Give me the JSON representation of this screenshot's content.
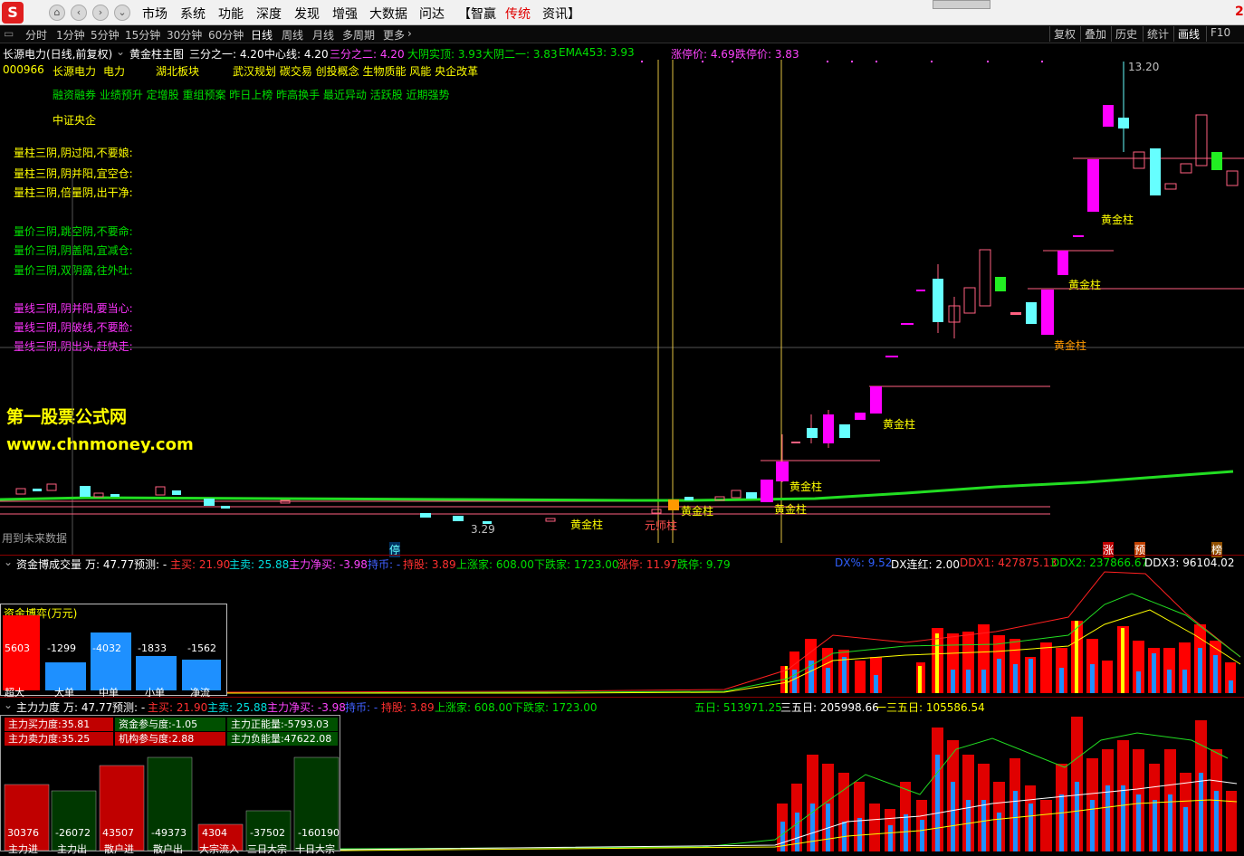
{
  "topbar": {
    "logo": "S",
    "menu": [
      "市场",
      "系统",
      "功能",
      "深度",
      "发现",
      "增强",
      "大数据",
      "问达",
      "【智赢",
      "传统",
      "资讯】"
    ],
    "active_menu": "传统",
    "clock_partial": "2"
  },
  "timeframes": [
    "分时",
    "1分钟",
    "5分钟",
    "15分钟",
    "30分钟",
    "60分钟",
    "日线",
    "周线",
    "月线",
    "多周期",
    "更多"
  ],
  "right_tools": [
    "复权",
    "叠加",
    "历史",
    "统计",
    "画线",
    "F10"
  ],
  "main_header": {
    "stock_title": "长源电力(日线,前复权)",
    "indicator": "黄金柱主图",
    "items": [
      {
        "text": "三分之一: 4.20",
        "color": "#ffffff"
      },
      {
        "text": "中心线: 4.20",
        "color": "#ffffff"
      },
      {
        "text": "三分之二: 4.20",
        "color": "#ff44ff"
      },
      {
        "text": "大阴实顶: 3.93",
        "color": "#00e000"
      },
      {
        "text": "大阴二一: 3.83",
        "color": "#00e000"
      },
      {
        "text": "EMA453: 3.93",
        "color": "#00e000"
      },
      {
        "text": "涨停价: 4.69",
        "color": "#ff44ff"
      },
      {
        "text": "跌停价: 3.83",
        "color": "#ff44ff"
      }
    ]
  },
  "stock_info": {
    "code": "000966",
    "name": "长源电力",
    "industry": "电力",
    "region": "湖北板块",
    "concepts": "武汉规划 碳交易 创投概念 生物质能 风能 央企改革",
    "tags": "融资融券 业绩预升 定增股 重组预案 昨日上榜 昨高换手 最近异动 活跃股 近期强势",
    "index": "中证央企"
  },
  "rules": {
    "yellow": [
      "量柱三阴,阴过阳,不要娘:",
      "量柱三阴,阴并阳,宜空仓:",
      "量柱三阴,倍量阴,出干净:"
    ],
    "green": [
      "量价三阴,跳空阴,不要命:",
      "量价三阴,阴盖阳,宜减仓:",
      "量价三阴,双阴露,往外吐:"
    ],
    "magenta": [
      "量线三阴,阴并阳,要当心:",
      "量线三阴,阴破线,不要脸:",
      "量线三阴,阴出头,赶快走:"
    ]
  },
  "watermark": {
    "name": "第一股票公式网",
    "url": "www.chnmoney.com"
  },
  "chart_notes": {
    "future_data": "用到未来数据",
    "high_price": "13.20",
    "low_price": "3.29",
    "stop_marker": "停",
    "bottom_markers": [
      "涨",
      "预",
      "榜"
    ],
    "golden_labels": [
      "黄金柱",
      "黄金柱",
      "黄金柱",
      "黄金柱",
      "黄金柱",
      "黄金柱",
      "黄金柱",
      "黄金柱"
    ],
    "start_label": "元师柱"
  },
  "panel2_header": {
    "name": "资金博成交量",
    "items": [
      {
        "text": "万: 47.77",
        "color": "#ffffff"
      },
      {
        "text": "预测: -",
        "color": "#ffffff"
      },
      {
        "text": "主买: 21.90",
        "color": "#ff3030"
      },
      {
        "text": "主卖: 25.88",
        "color": "#00e0e0"
      },
      {
        "text": "主力净买: -3.98",
        "color": "#ff44ff"
      },
      {
        "text": "持币: -",
        "color": "#4060ff"
      },
      {
        "text": "持股: 3.89",
        "color": "#ff3030"
      },
      {
        "text": "上涨家: 608.00",
        "color": "#00e000"
      },
      {
        "text": "下跌家: 1723.00",
        "color": "#00e000"
      },
      {
        "text": "涨停: 11.97",
        "color": "#ff3030"
      },
      {
        "text": "跌停: 9.79",
        "color": "#00e000"
      }
    ],
    "right": [
      {
        "text": "DX%: 9.52",
        "color": "#3060ff"
      },
      {
        "text": "DX连红: 2.00",
        "color": "#ffffff"
      },
      {
        "text": "DDX1: 427875.13",
        "color": "#ff3030"
      },
      {
        "text": "DDX2: 237866.67",
        "color": "#00e000"
      },
      {
        "text": "DDX3: 96104.02",
        "color": "#ffffff"
      }
    ]
  },
  "capital_game": {
    "title": "资金博弈(万元)",
    "bars": [
      {
        "label": "超大",
        "value": 5603,
        "color": "#ff0000"
      },
      {
        "label": "大单",
        "value": -1299,
        "color": "#1e90ff"
      },
      {
        "label": "中单",
        "value": -4032,
        "color": "#1e90ff"
      },
      {
        "label": "小单",
        "value": -1833,
        "color": "#1e90ff"
      },
      {
        "label": "净流",
        "value": -1562,
        "color": "#1e90ff"
      }
    ]
  },
  "panel3_header": {
    "name": "主力力度",
    "items": [
      {
        "text": "万: 47.77",
        "color": "#ffffff"
      },
      {
        "text": "预测: -",
        "color": "#ffffff"
      },
      {
        "text": "主买: 21.90",
        "color": "#ff3030"
      },
      {
        "text": "主卖: 25.88",
        "color": "#00e0e0"
      },
      {
        "text": "主力净买: -3.98",
        "color": "#ff44ff"
      },
      {
        "text": "持币: -",
        "color": "#4060ff"
      },
      {
        "text": "持股: 3.89",
        "color": "#ff3030"
      },
      {
        "text": "上涨家: 608.00",
        "color": "#00e000"
      },
      {
        "text": "下跌家: 1723.00",
        "color": "#00e000"
      }
    ],
    "right": [
      {
        "text": "五日: 513971.25",
        "color": "#00e000"
      },
      {
        "text": "三五日: 205998.66",
        "color": "#ffffff"
      },
      {
        "text": "一三五日: 105586.54",
        "color": "#ffff00"
      }
    ]
  },
  "power": {
    "cells": [
      {
        "text": "主力买力度:35.81",
        "bg": "#c00000"
      },
      {
        "text": "资金参与度:-1.05",
        "bg": "#005000"
      },
      {
        "text": "主力正能量:-5793.03",
        "bg": "#005000"
      },
      {
        "text": "主力卖力度:35.25",
        "bg": "#c00000"
      },
      {
        "text": "机构参与度:2.88",
        "bg": "#c00000"
      },
      {
        "text": "主力负能量:47622.08",
        "bg": "#005000"
      }
    ],
    "bars": [
      {
        "label": "主力进",
        "value": 30376,
        "color": "#c00000"
      },
      {
        "label": "主力出",
        "value": -26072,
        "color": "#003800"
      },
      {
        "label": "散户进",
        "value": 43507,
        "color": "#c00000"
      },
      {
        "label": "散户出",
        "value": -49373,
        "color": "#003800"
      },
      {
        "label": "大宗流入",
        "value": 4304,
        "color": "#c00000"
      },
      {
        "label": "三日大宗",
        "value": -37502,
        "color": "#003800"
      },
      {
        "label": "十日大宗",
        "value": -160190,
        "color": "#003800"
      }
    ]
  }
}
